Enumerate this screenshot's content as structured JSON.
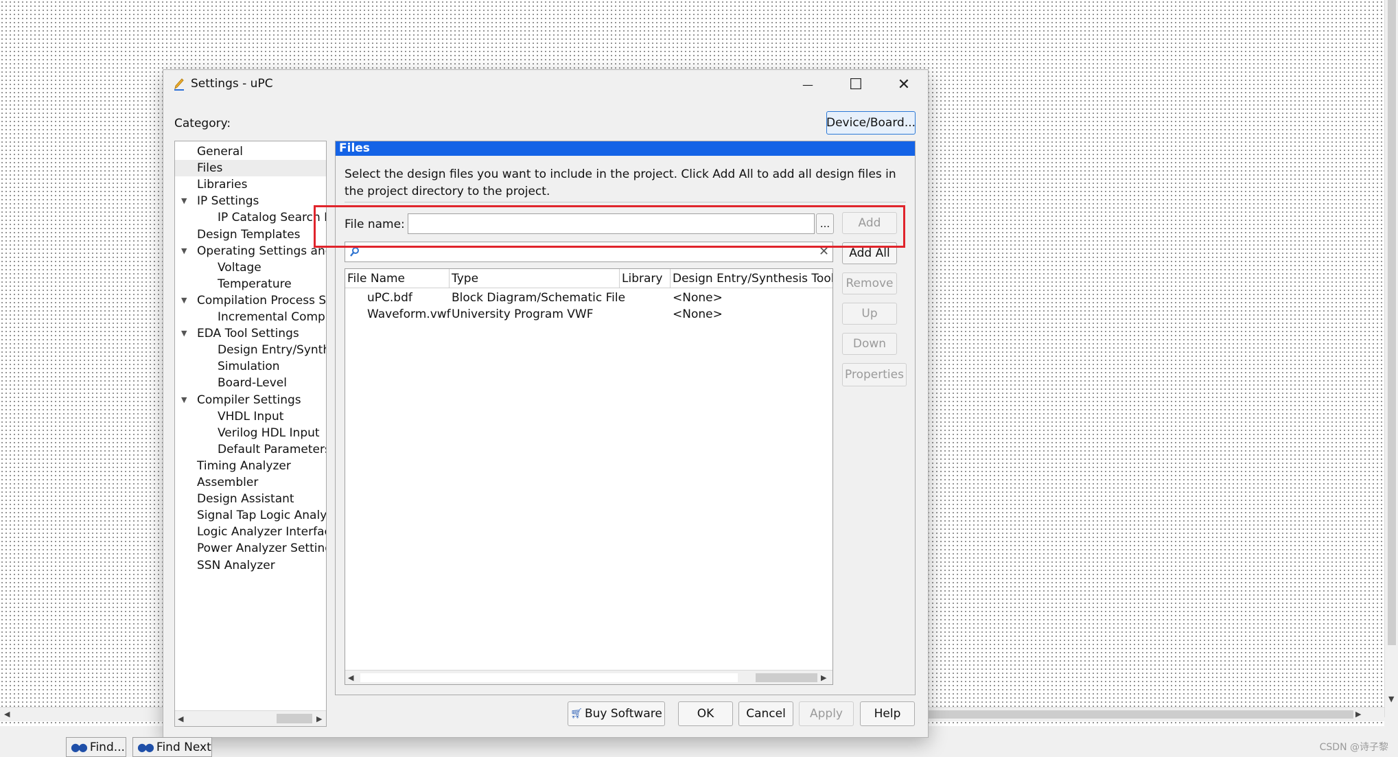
{
  "window": {
    "title": "Settings - uPC",
    "minimize": "—",
    "maximize": "☐",
    "close": "✕"
  },
  "category_label": "Category:",
  "device_board_button": "Device/Board...",
  "tree": [
    {
      "label": "General",
      "indent": 0,
      "expander": false
    },
    {
      "label": "Files",
      "indent": 0,
      "expander": false,
      "selected": true
    },
    {
      "label": "Libraries",
      "indent": 0,
      "expander": false
    },
    {
      "label": "IP Settings",
      "indent": 0,
      "expander": true
    },
    {
      "label": "IP Catalog Search Lo",
      "indent": 1,
      "expander": false
    },
    {
      "label": "Design Templates",
      "indent": 0,
      "expander": false
    },
    {
      "label": "Operating Settings and",
      "indent": 0,
      "expander": true
    },
    {
      "label": "Voltage",
      "indent": 1,
      "expander": false
    },
    {
      "label": "Temperature",
      "indent": 1,
      "expander": false
    },
    {
      "label": "Compilation Process Se",
      "indent": 0,
      "expander": true
    },
    {
      "label": "Incremental Compil",
      "indent": 1,
      "expander": false
    },
    {
      "label": "EDA Tool Settings",
      "indent": 0,
      "expander": true
    },
    {
      "label": "Design Entry/Synth",
      "indent": 1,
      "expander": false
    },
    {
      "label": "Simulation",
      "indent": 1,
      "expander": false
    },
    {
      "label": "Board-Level",
      "indent": 1,
      "expander": false
    },
    {
      "label": "Compiler Settings",
      "indent": 0,
      "expander": true
    },
    {
      "label": "VHDL Input",
      "indent": 1,
      "expander": false
    },
    {
      "label": "Verilog HDL Input",
      "indent": 1,
      "expander": false
    },
    {
      "label": "Default Parameters",
      "indent": 1,
      "expander": false
    },
    {
      "label": "Timing Analyzer",
      "indent": 0,
      "expander": false
    },
    {
      "label": "Assembler",
      "indent": 0,
      "expander": false
    },
    {
      "label": "Design Assistant",
      "indent": 0,
      "expander": false
    },
    {
      "label": "Signal Tap Logic Analyz",
      "indent": 0,
      "expander": false
    },
    {
      "label": "Logic Analyzer Interfac",
      "indent": 0,
      "expander": false
    },
    {
      "label": "Power Analyzer Setting",
      "indent": 0,
      "expander": false
    },
    {
      "label": "SSN Analyzer",
      "indent": 0,
      "expander": false
    }
  ],
  "files_panel": {
    "header": "Files",
    "description": "Select the design files you want to include in the project. Click Add All to add all design files in the project directory to the project.",
    "file_name_label": "File name:",
    "file_name_value": "",
    "browse_button": "...",
    "filter_value": "",
    "filter_clear": "✕",
    "buttons": {
      "add": "Add",
      "add_all": "Add All",
      "remove": "Remove",
      "up": "Up",
      "down": "Down",
      "properties": "Properties"
    },
    "table": {
      "columns": [
        "File Name",
        "Type",
        "Library",
        "Design Entry/Synthesis Tool"
      ],
      "rows": [
        {
          "file_name": "uPC.bdf",
          "type": "Block Diagram/Schematic File",
          "library": "",
          "tool": "<None>"
        },
        {
          "file_name": "Waveform.vwf",
          "type": "University Program VWF",
          "library": "",
          "tool": "<None>"
        }
      ]
    }
  },
  "footer_buttons": {
    "buy_software": "Buy Software",
    "ok": "OK",
    "cancel": "Cancel",
    "apply": "Apply",
    "help": "Help"
  },
  "taskbar": {
    "find": "Find...",
    "find_next": "Find Next"
  },
  "watermark": "CSDN @诗子黎"
}
